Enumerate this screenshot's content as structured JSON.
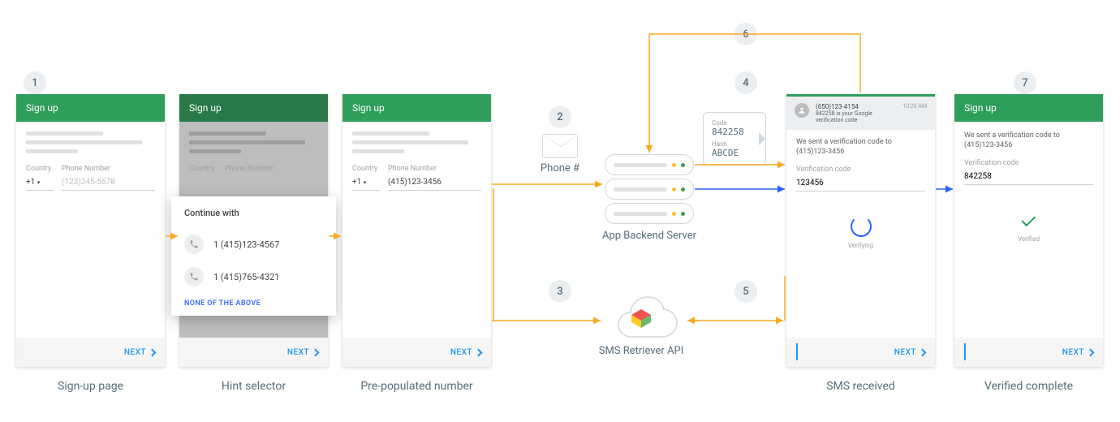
{
  "badges": {
    "1": "1",
    "2": "2",
    "3": "3",
    "4": "4",
    "5": "5",
    "6": "6",
    "7": "7"
  },
  "captions": {
    "signup": "Sign-up page",
    "hint": "Hint selector",
    "prepop": "Pre-populated number",
    "sms": "SMS received",
    "verified": "Verified complete"
  },
  "common": {
    "signup_title": "Sign up",
    "next": "NEXT",
    "country_label": "Country",
    "phone_label": "Phone Number",
    "country_value": "+1",
    "phone_placeholder": "(123)345-5678",
    "phone_value": "(415)123-3456"
  },
  "hint": {
    "title": "Continue with",
    "opt1": "1 (415)123-4567",
    "opt2": "1 (415)765-4321",
    "none": "NONE OF THE ABOVE"
  },
  "mid": {
    "phone_hash": "Phone #",
    "backend": "App Backend Server",
    "retriever": "SMS Retriever API"
  },
  "code_bubble": {
    "code_label": "Code",
    "code_value": "842258",
    "hash_label": "Hash",
    "hash_value": "ABCDE"
  },
  "notif": {
    "from": "(650)123-4154",
    "time": "10:26 AM",
    "msg": "842258 is your Google verification code"
  },
  "verify": {
    "sent_to_1": "We sent a verification code to",
    "sent_to_2": "(415)123-3456",
    "code_label": "Verification code",
    "code_placeholder": "123456",
    "code_value": "842258",
    "verifying": "Verifying",
    "verified": "Verified"
  }
}
